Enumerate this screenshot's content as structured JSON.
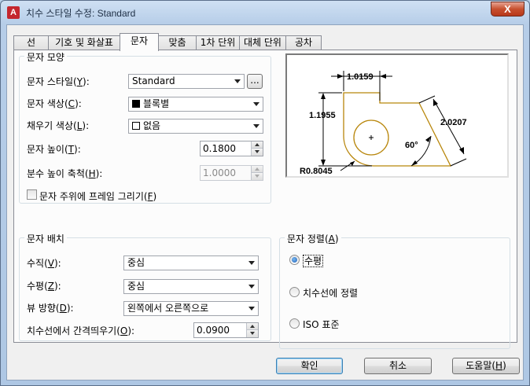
{
  "window": {
    "title": "치수 스타일 수정: Standard",
    "close_label": "X"
  },
  "tabs": [
    {
      "label": "선"
    },
    {
      "label": "기호 및 화살표"
    },
    {
      "label": "문자"
    },
    {
      "label": "맞춤"
    },
    {
      "label": "1차 단위"
    },
    {
      "label": "대체 단위"
    },
    {
      "label": "공차"
    }
  ],
  "active_tab": "문자",
  "text_appearance": {
    "group_label": "문자 모양",
    "style_label_pre": "문자 스타일(",
    "style_label_key": "Y",
    "style_label_post": "):",
    "style_value": "Standard",
    "browse_label": "...",
    "color_label_pre": "문자 색상(",
    "color_label_key": "C",
    "color_label_post": "):",
    "color_value": "블록별",
    "fill_label_pre": "채우기 색상(",
    "fill_label_key": "L",
    "fill_label_post": "):",
    "fill_value": "없음",
    "height_label_pre": "문자 높이(",
    "height_label_key": "T",
    "height_label_post": "):",
    "height_value": "0.1800",
    "fraction_label_pre": "분수 높이 축척(",
    "fraction_label_key": "H",
    "fraction_label_post": "):",
    "fraction_value": "1.0000",
    "frame_label_pre": "문자 주위에 프레임 그리기(",
    "frame_label_key": "F",
    "frame_label_post": ")",
    "frame_checked": false
  },
  "text_placement": {
    "group_label": "문자 배치",
    "vertical_label_pre": "수직(",
    "vertical_label_key": "V",
    "vertical_label_post": "):",
    "vertical_value": "중심",
    "horizontal_label_pre": "수평(",
    "horizontal_label_key": "Z",
    "horizontal_label_post": "):",
    "horizontal_value": "중심",
    "view_label_pre": "뷰 방향(",
    "view_label_key": "D",
    "view_label_post": "):",
    "view_value": "왼쪽에서 오른쪽으로",
    "offset_label_pre": "치수선에서 간격띄우기(",
    "offset_label_key": "O",
    "offset_label_post": "):",
    "offset_value": "0.0900"
  },
  "text_alignment": {
    "group_label_pre": "문자 정렬(",
    "group_label_key": "A",
    "group_label_post": ")",
    "options": [
      {
        "label": "수평",
        "checked": true
      },
      {
        "label": "치수선에 정렬",
        "checked": false
      },
      {
        "label": "ISO 표준",
        "checked": false
      }
    ]
  },
  "preview": {
    "dim_top": "1.0159",
    "dim_left": "1.1955",
    "dim_right": "2.0207",
    "angle": "60°",
    "radius": "R0.8045",
    "outline_color": "#b8860b"
  },
  "buttons": {
    "ok": "확인",
    "cancel": "취소",
    "help_pre": "도움말(",
    "help_key": "H",
    "help_post": ")"
  },
  "colors": {
    "accent": "#3c7fb1",
    "title_bar": "#b9d1ea",
    "close_button": "#c7502f"
  }
}
